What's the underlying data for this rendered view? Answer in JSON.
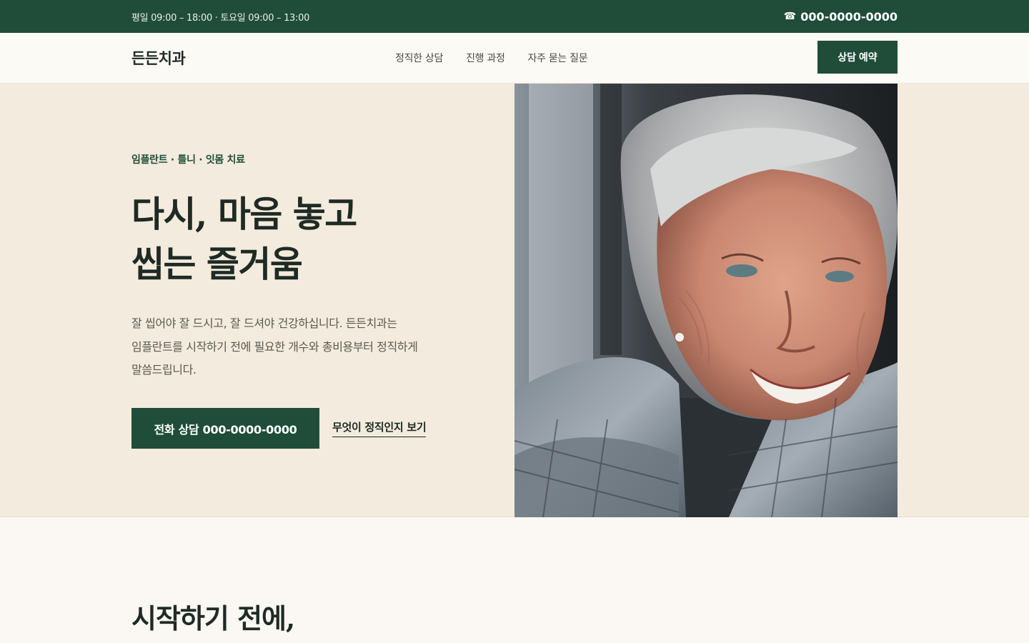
{
  "topbar": {
    "hours": "평일 09:00 – 18:00 · 토요일 09:00 – 13:00",
    "phone_icon": "phone-icon",
    "phone": "000-0000-0000"
  },
  "nav": {
    "logo": "든든치과",
    "menu": [
      {
        "label": "정직한 상담"
      },
      {
        "label": "진행 과정"
      },
      {
        "label": "자주 묻는 질문"
      }
    ],
    "cta": "상담 예약"
  },
  "hero": {
    "eyebrow": "임플란트 · 틀니 · 잇몸 치료",
    "title_line1": "다시, 마음 놓고",
    "title_line2": "씹는 즐거움",
    "desc_line1": "잘 씹어야 잘 드시고, 잘 드셔야 건강하십니다. 든든치과는",
    "desc_line2": "임플란트를 시작하기 전에 필요한 개수와 총비용부터 정직하게",
    "desc_line3": "말씀드립니다.",
    "primary_button": "전화 상담 000-0000-0000",
    "secondary_link": "무엇이 정직인지 보기"
  },
  "section2": {
    "heading": "시작하기 전에,"
  }
}
